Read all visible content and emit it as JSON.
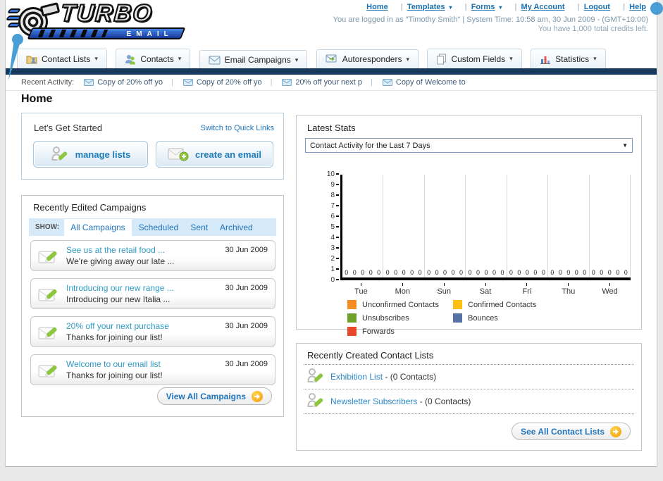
{
  "ui": {
    "caret_down": "▾",
    "select_arrow": "▼",
    "separator": "|"
  },
  "brand": {
    "title_top": "TURBO",
    "title_bottom": "EMAIL"
  },
  "topnav": {
    "links": [
      {
        "label": "Home",
        "has_menu": false
      },
      {
        "label": "Templates",
        "has_menu": true
      },
      {
        "label": "Forms",
        "has_menu": true
      },
      {
        "label": "My Account",
        "has_menu": false
      },
      {
        "label": "Logout",
        "has_menu": false
      },
      {
        "label": "Help",
        "has_menu": false
      }
    ]
  },
  "session": {
    "line1": "You are logged in as \"Timothy Smith\" | System Time: 10:58 am, 30 Jun 2009 - (GMT+10:00)",
    "line2": "You have 1,000 total credits left."
  },
  "tabs": [
    {
      "label": "Contact Lists",
      "icon": "folder-contact-icon"
    },
    {
      "label": "Contacts",
      "icon": "people-icon"
    },
    {
      "label": "Email Campaigns",
      "icon": "envelope-icon"
    },
    {
      "label": "Autoresponders",
      "icon": "envelope-arrow-icon"
    },
    {
      "label": "Custom Fields",
      "icon": "pages-icon"
    },
    {
      "label": "Statistics",
      "icon": "bar-chart-icon"
    }
  ],
  "recent_activity": {
    "label": "Recent Activity:",
    "items": [
      "Copy of 20% off yo",
      "Copy of 20% off yo",
      "20% off your next p",
      "Copy of Welcome to"
    ]
  },
  "page": {
    "title": "Home"
  },
  "get_started": {
    "title": "Let's Get Started",
    "switch_link": "Switch to Quick Links",
    "buttons": [
      {
        "label": "manage lists",
        "icon": "person-pencil-icon"
      },
      {
        "label": "create an email",
        "icon": "envelope-plus-icon"
      }
    ]
  },
  "campaigns": {
    "title": "Recently Edited Campaigns",
    "show_label": "SHOW:",
    "filters": [
      {
        "label": "All Campaigns",
        "active": true
      },
      {
        "label": "Scheduled",
        "active": false
      },
      {
        "label": "Sent",
        "active": false
      },
      {
        "label": "Archived",
        "active": false
      }
    ],
    "items": [
      {
        "title": "See us at the retail food ...",
        "subtitle": "We're giving away our late ...",
        "date": "30 Jun 2009"
      },
      {
        "title": "Introducing our new range ...",
        "subtitle": "Introducing our new Italia ...",
        "date": "30 Jun 2009"
      },
      {
        "title": "20% off your next purchase",
        "subtitle": "Thanks for joining our list!",
        "date": "30 Jun 2009"
      },
      {
        "title": "Welcome to our email list",
        "subtitle": "Thanks for joining our list!",
        "date": "30 Jun 2009"
      }
    ],
    "view_all_label": "View All Campaigns"
  },
  "stats": {
    "title": "Latest Stats",
    "selected_report": "Contact Activity for the Last 7 Days"
  },
  "chart_data": {
    "type": "bar",
    "title": "Contact Activity for the Last 7 Days",
    "categories": [
      "Tue",
      "Mon",
      "Sun",
      "Sat",
      "Fri",
      "Thu",
      "Wed"
    ],
    "series": [
      {
        "name": "Unconfirmed Contacts",
        "color": "#f68b1f",
        "values": [
          0,
          0,
          0,
          0,
          0,
          0,
          0
        ]
      },
      {
        "name": "Confirmed Contacts",
        "color": "#fdc010",
        "values": [
          0,
          0,
          0,
          0,
          0,
          0,
          0
        ]
      },
      {
        "name": "Unsubscribes",
        "color": "#6fa22a",
        "values": [
          0,
          0,
          0,
          0,
          0,
          0,
          0
        ]
      },
      {
        "name": "Bounces",
        "color": "#5572a7",
        "values": [
          0,
          0,
          0,
          0,
          0,
          0,
          0
        ]
      },
      {
        "name": "Forwards",
        "color": "#e8472b",
        "values": [
          0,
          0,
          0,
          0,
          0,
          0,
          0
        ]
      }
    ],
    "xlabel": "",
    "ylabel": "",
    "ylim": [
      0,
      10
    ],
    "ytick_step": 1,
    "grid": "vertical",
    "legend_position": "bottom",
    "value_labels_shown": true
  },
  "contact_lists": {
    "title": "Recently Created Contact Lists",
    "items": [
      {
        "name": "Exhibition List",
        "meta": " - (0 Contacts)"
      },
      {
        "name": "Newsletter Subscribers",
        "meta": " - (0 Contacts)"
      }
    ],
    "see_all_label": "See All Contact Lists"
  }
}
